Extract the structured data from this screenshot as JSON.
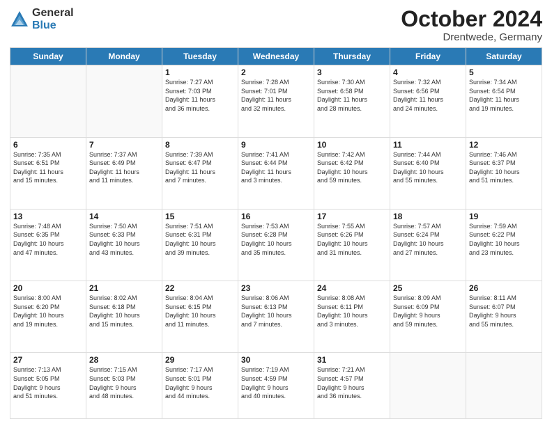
{
  "header": {
    "logo_general": "General",
    "logo_blue": "Blue",
    "month_year": "October 2024",
    "location": "Drentwede, Germany"
  },
  "days_of_week": [
    "Sunday",
    "Monday",
    "Tuesday",
    "Wednesday",
    "Thursday",
    "Friday",
    "Saturday"
  ],
  "weeks": [
    [
      {
        "day": "",
        "info": ""
      },
      {
        "day": "",
        "info": ""
      },
      {
        "day": "1",
        "info": "Sunrise: 7:27 AM\nSunset: 7:03 PM\nDaylight: 11 hours\nand 36 minutes."
      },
      {
        "day": "2",
        "info": "Sunrise: 7:28 AM\nSunset: 7:01 PM\nDaylight: 11 hours\nand 32 minutes."
      },
      {
        "day": "3",
        "info": "Sunrise: 7:30 AM\nSunset: 6:58 PM\nDaylight: 11 hours\nand 28 minutes."
      },
      {
        "day": "4",
        "info": "Sunrise: 7:32 AM\nSunset: 6:56 PM\nDaylight: 11 hours\nand 24 minutes."
      },
      {
        "day": "5",
        "info": "Sunrise: 7:34 AM\nSunset: 6:54 PM\nDaylight: 11 hours\nand 19 minutes."
      }
    ],
    [
      {
        "day": "6",
        "info": "Sunrise: 7:35 AM\nSunset: 6:51 PM\nDaylight: 11 hours\nand 15 minutes."
      },
      {
        "day": "7",
        "info": "Sunrise: 7:37 AM\nSunset: 6:49 PM\nDaylight: 11 hours\nand 11 minutes."
      },
      {
        "day": "8",
        "info": "Sunrise: 7:39 AM\nSunset: 6:47 PM\nDaylight: 11 hours\nand 7 minutes."
      },
      {
        "day": "9",
        "info": "Sunrise: 7:41 AM\nSunset: 6:44 PM\nDaylight: 11 hours\nand 3 minutes."
      },
      {
        "day": "10",
        "info": "Sunrise: 7:42 AM\nSunset: 6:42 PM\nDaylight: 10 hours\nand 59 minutes."
      },
      {
        "day": "11",
        "info": "Sunrise: 7:44 AM\nSunset: 6:40 PM\nDaylight: 10 hours\nand 55 minutes."
      },
      {
        "day": "12",
        "info": "Sunrise: 7:46 AM\nSunset: 6:37 PM\nDaylight: 10 hours\nand 51 minutes."
      }
    ],
    [
      {
        "day": "13",
        "info": "Sunrise: 7:48 AM\nSunset: 6:35 PM\nDaylight: 10 hours\nand 47 minutes."
      },
      {
        "day": "14",
        "info": "Sunrise: 7:50 AM\nSunset: 6:33 PM\nDaylight: 10 hours\nand 43 minutes."
      },
      {
        "day": "15",
        "info": "Sunrise: 7:51 AM\nSunset: 6:31 PM\nDaylight: 10 hours\nand 39 minutes."
      },
      {
        "day": "16",
        "info": "Sunrise: 7:53 AM\nSunset: 6:28 PM\nDaylight: 10 hours\nand 35 minutes."
      },
      {
        "day": "17",
        "info": "Sunrise: 7:55 AM\nSunset: 6:26 PM\nDaylight: 10 hours\nand 31 minutes."
      },
      {
        "day": "18",
        "info": "Sunrise: 7:57 AM\nSunset: 6:24 PM\nDaylight: 10 hours\nand 27 minutes."
      },
      {
        "day": "19",
        "info": "Sunrise: 7:59 AM\nSunset: 6:22 PM\nDaylight: 10 hours\nand 23 minutes."
      }
    ],
    [
      {
        "day": "20",
        "info": "Sunrise: 8:00 AM\nSunset: 6:20 PM\nDaylight: 10 hours\nand 19 minutes."
      },
      {
        "day": "21",
        "info": "Sunrise: 8:02 AM\nSunset: 6:18 PM\nDaylight: 10 hours\nand 15 minutes."
      },
      {
        "day": "22",
        "info": "Sunrise: 8:04 AM\nSunset: 6:15 PM\nDaylight: 10 hours\nand 11 minutes."
      },
      {
        "day": "23",
        "info": "Sunrise: 8:06 AM\nSunset: 6:13 PM\nDaylight: 10 hours\nand 7 minutes."
      },
      {
        "day": "24",
        "info": "Sunrise: 8:08 AM\nSunset: 6:11 PM\nDaylight: 10 hours\nand 3 minutes."
      },
      {
        "day": "25",
        "info": "Sunrise: 8:09 AM\nSunset: 6:09 PM\nDaylight: 9 hours\nand 59 minutes."
      },
      {
        "day": "26",
        "info": "Sunrise: 8:11 AM\nSunset: 6:07 PM\nDaylight: 9 hours\nand 55 minutes."
      }
    ],
    [
      {
        "day": "27",
        "info": "Sunrise: 7:13 AM\nSunset: 5:05 PM\nDaylight: 9 hours\nand 51 minutes."
      },
      {
        "day": "28",
        "info": "Sunrise: 7:15 AM\nSunset: 5:03 PM\nDaylight: 9 hours\nand 48 minutes."
      },
      {
        "day": "29",
        "info": "Sunrise: 7:17 AM\nSunset: 5:01 PM\nDaylight: 9 hours\nand 44 minutes."
      },
      {
        "day": "30",
        "info": "Sunrise: 7:19 AM\nSunset: 4:59 PM\nDaylight: 9 hours\nand 40 minutes."
      },
      {
        "day": "31",
        "info": "Sunrise: 7:21 AM\nSunset: 4:57 PM\nDaylight: 9 hours\nand 36 minutes."
      },
      {
        "day": "",
        "info": ""
      },
      {
        "day": "",
        "info": ""
      }
    ]
  ]
}
